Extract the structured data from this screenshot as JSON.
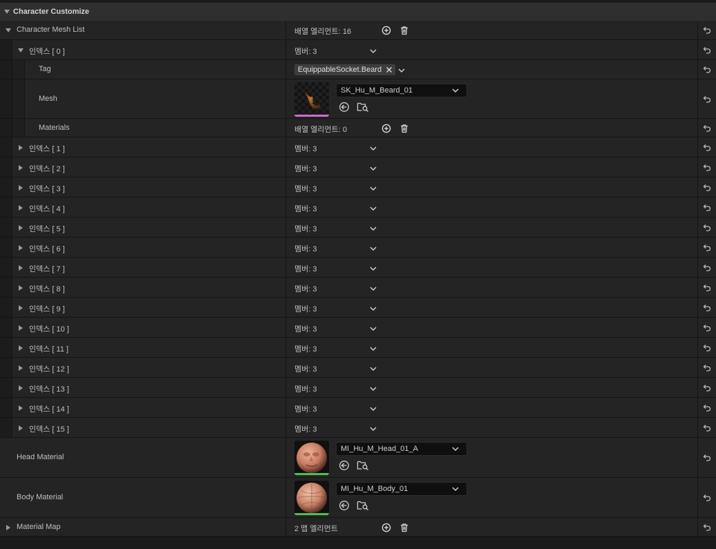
{
  "header": {
    "title": "Character Customize"
  },
  "mesh_list": {
    "label": "Character Mesh List",
    "value": "배열 엘리먼트: 16",
    "index0": {
      "label": "인덱스 [ 0 ]",
      "value": "멤버: 3",
      "tag": {
        "label": "Tag",
        "chip": "EquippableSocket.Beard"
      },
      "mesh": {
        "label": "Mesh",
        "asset": "SK_Hu_M_Beard_01"
      },
      "materials": {
        "label": "Materials",
        "value": "배열 엘리먼트: 0"
      }
    },
    "items": [
      {
        "label": "인덱스 [ 1 ]",
        "value": "멤버: 3"
      },
      {
        "label": "인덱스 [ 2 ]",
        "value": "멤버: 3"
      },
      {
        "label": "인덱스 [ 3 ]",
        "value": "멤버: 3"
      },
      {
        "label": "인덱스 [ 4 ]",
        "value": "멤버: 3"
      },
      {
        "label": "인덱스 [ 5 ]",
        "value": "멤버: 3"
      },
      {
        "label": "인덱스 [ 6 ]",
        "value": "멤버: 3"
      },
      {
        "label": "인덱스 [ 7 ]",
        "value": "멤버: 3"
      },
      {
        "label": "인덱스 [ 8 ]",
        "value": "멤버: 3"
      },
      {
        "label": "인덱스 [ 9 ]",
        "value": "멤버: 3"
      },
      {
        "label": "인덱스 [ 10 ]",
        "value": "멤버: 3"
      },
      {
        "label": "인덱스 [ 11 ]",
        "value": "멤버: 3"
      },
      {
        "label": "인덱스 [ 12 ]",
        "value": "멤버: 3"
      },
      {
        "label": "인덱스 [ 13 ]",
        "value": "멤버: 3"
      },
      {
        "label": "인덱스 [ 14 ]",
        "value": "멤버: 3"
      },
      {
        "label": "인덱스 [ 15 ]",
        "value": "멤버: 3"
      }
    ]
  },
  "head_material": {
    "label": "Head Material",
    "asset": "MI_Hu_M_Head_01_A"
  },
  "body_material": {
    "label": "Body Material",
    "asset": "MI_Hu_M_Body_01"
  },
  "material_map": {
    "label": "Material Map",
    "value": "2 맵 엘리먼트"
  },
  "colors": {
    "background": "#1a1a1a",
    "row": "#242424",
    "header": "#2f2f2f",
    "mesh_asset_bar": "#d36ad6",
    "material_asset_bar": "#4ec24a"
  },
  "icons": {
    "add": "plus-circle-icon",
    "delete": "trash-icon",
    "reset": "reset-arrow-icon",
    "browse": "use-selected-arrow-icon",
    "find": "browse-folder-icon"
  }
}
